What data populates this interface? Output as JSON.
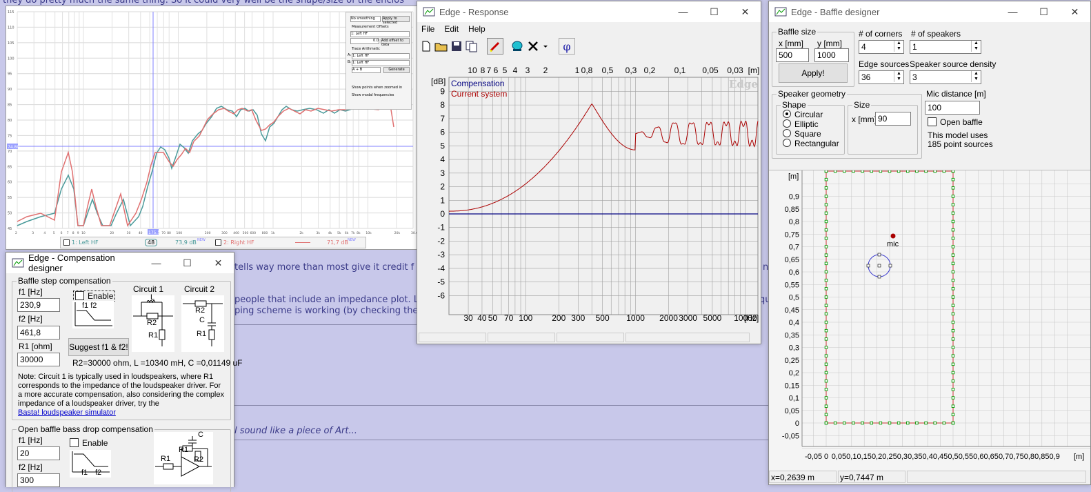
{
  "background": {
    "top_text": "they do pretty much the same thing. So it could very well be the shape/size of the enclos",
    "text1": "tells way more than most give it credit f",
    "text1_right": "n",
    "text2": "people that include an impedance plot. L",
    "text2_right": "qu",
    "text3": "ping scheme is working (by checking the",
    "text4": "l sound like a piece of Art...",
    "colors": {
      "bg": "#c8c8ea"
    }
  },
  "rew_graph": {
    "y_labels": [
      "115",
      "110",
      "105",
      "100",
      "95",
      "90",
      "85",
      "80",
      "75",
      "70",
      "65",
      "60",
      "55",
      "50",
      "45"
    ],
    "x_labels": [
      "2",
      "3",
      "4",
      "5",
      "6",
      "7",
      "8",
      "9",
      "10",
      "20",
      "30",
      "40",
      "50",
      "60",
      "70",
      "80",
      "100",
      "200",
      "300",
      "400",
      "500",
      "600",
      "800",
      "1k",
      "2k",
      "3k",
      "4k",
      "5k",
      "6k",
      "7k",
      "8k",
      "10k",
      "20k",
      "30.0k Hz"
    ],
    "cursor_value": "74.80",
    "marker": "175.5",
    "legend": {
      "left_name": "1: Left HF",
      "left_db": "73,9 dB",
      "right_name": "2: Right HF",
      "right_db": "71,7 dB",
      "new_tag": "NEW",
      "smooth_btn": "48"
    },
    "panel": {
      "smoothing": "No smoothing",
      "apply_btn": "Apply to selected",
      "offsets_label": "Measurement Offsets",
      "meas": "1: Left HF",
      "offset_val": "0.0",
      "add_offset_btn": "Add offset to data",
      "trace_label": "Trace Arithmetic",
      "a_label": "A:",
      "a_val": "1: Left HF",
      "b_label": "B:",
      "b_val": "1: Left HF",
      "op_val": "A + B",
      "generate_btn": "Generate",
      "show_points": "Show points when zoomed in",
      "show_modal": "Show modal frequencies"
    },
    "colors": {
      "teal": "#4a9a9a",
      "red": "#e07070"
    }
  },
  "response": {
    "title": "Edge - Response",
    "menu": [
      "File",
      "Edit",
      "Help"
    ],
    "toolbar_icons": [
      "new-file-icon",
      "open-folder-icon",
      "save-icon",
      "copy-icon",
      "pen-icon",
      "sound-icon",
      "close-x-icon",
      "dropdown-icon",
      "phase-icon"
    ],
    "phi": "φ",
    "y_unit": "[dB]",
    "y_labels": [
      "9",
      "8",
      "7",
      "6",
      "5",
      "4",
      "3",
      "2",
      "1",
      "0",
      "-1",
      "-2",
      "-3",
      "-4",
      "-5",
      "-6"
    ],
    "x_labels": [
      "30",
      "40",
      "50",
      "70",
      "100",
      "200",
      "300",
      "500",
      "1000",
      "2000",
      "3000",
      "5000",
      "10000",
      "[Hz]"
    ],
    "top_labels": [
      "10",
      "8",
      "7",
      "6",
      "5",
      "4",
      "3",
      "2",
      "1",
      "0,8",
      "0,5",
      "0,3",
      "0,2",
      "0,1",
      "0,05",
      "0,03",
      "[m]"
    ],
    "legend": [
      "Compensation",
      "Current system"
    ],
    "watermark": "Edge",
    "colors": {
      "comp": "#000080",
      "current": "#aa0000"
    }
  },
  "baffle": {
    "title": "Edge - Baffle designer",
    "baffle_size": "Baffle size",
    "x_label": "x [mm]",
    "y_label": "y [mm]",
    "x_val": "500",
    "y_val": "1000",
    "apply": "Apply!",
    "corners_label": "# of corners",
    "corners_val": "4",
    "speakers_label": "# of speakers",
    "speakers_val": "1",
    "edge_label": "Edge sources",
    "edge_val": "36",
    "density_label": "Speaker source density",
    "density_val": "3",
    "geometry": "Speaker geometry",
    "shape": "Shape",
    "shapes": [
      "Circular",
      "Elliptic",
      "Square",
      "Rectangular"
    ],
    "size": "Size",
    "size_x_label": "x [mm]",
    "size_val": "90",
    "mic_label": "Mic distance [m]",
    "mic_val": "100",
    "open_baffle": "Open baffle",
    "model_note_1": "This model uses",
    "model_note_2": "185 point sources",
    "plot_unit": "[m]",
    "y_labels": [
      "0,9",
      "0,85",
      "0,8",
      "0,75",
      "0,7",
      "0,65",
      "0,6",
      "0,55",
      "0,5",
      "0,45",
      "0,4",
      "0,35",
      "0,3",
      "0,25",
      "0,2",
      "0,15",
      "0,1",
      "0,05",
      "0",
      "-0,05"
    ],
    "x_labels": [
      "-0,05",
      "0",
      "0,05",
      "0,1",
      "0,15",
      "0,2",
      "0,25",
      "0,3",
      "0,35",
      "0,4",
      "0,45",
      "0,5",
      "0,55",
      "0,6",
      "0,65",
      "0,7",
      "0,75",
      "0,8",
      "0,85",
      "0,9"
    ],
    "x_unit": "[m]",
    "mic_tag": "mic",
    "status_x": "x=0,2639 m",
    "status_y": "y=0,7447 m"
  },
  "comp": {
    "title": "Edge - Compensation designer",
    "bsc_group": "Baffle step compensation",
    "f1_label": "f1 [Hz]",
    "f1_val": "230,9",
    "f2_label": "f2 [Hz]",
    "f2_val": "461,8",
    "r1_label": "R1 [ohm]",
    "r1_val": "30000",
    "enable": "Enable",
    "f1f2": "f1 f2",
    "circuit1": "Circuit 1",
    "circuit2": "Circuit 2",
    "suggest": "Suggest f1 & f2!",
    "formula": "R2=30000 ohm, L =10340 mH, C =0,01149 uF",
    "note1": "Note: Circuit 1 is typically used in loudspeakers, where R1",
    "note2": "corresponds to the impedance of the loudspeaker driver. For",
    "note3": "a more accurate compensation, also considering the complex",
    "note4": "impedance of a loudspeaker driver, try the",
    "link": "Basta! loudspeaker simulator",
    "ob_group": "Open baffle bass drop compensation",
    "ob_f1_label": "f1 [Hz]",
    "ob_f1_val": "20",
    "ob_f2_label": "f2 [Hz]",
    "ob_f2_val": "300",
    "ob_enable": "Enable",
    "ob_f1": "f1",
    "ob_f2": "f2",
    "c_L": "L",
    "c_R1": "R1",
    "c_R2": "R2",
    "c_C": "C"
  }
}
